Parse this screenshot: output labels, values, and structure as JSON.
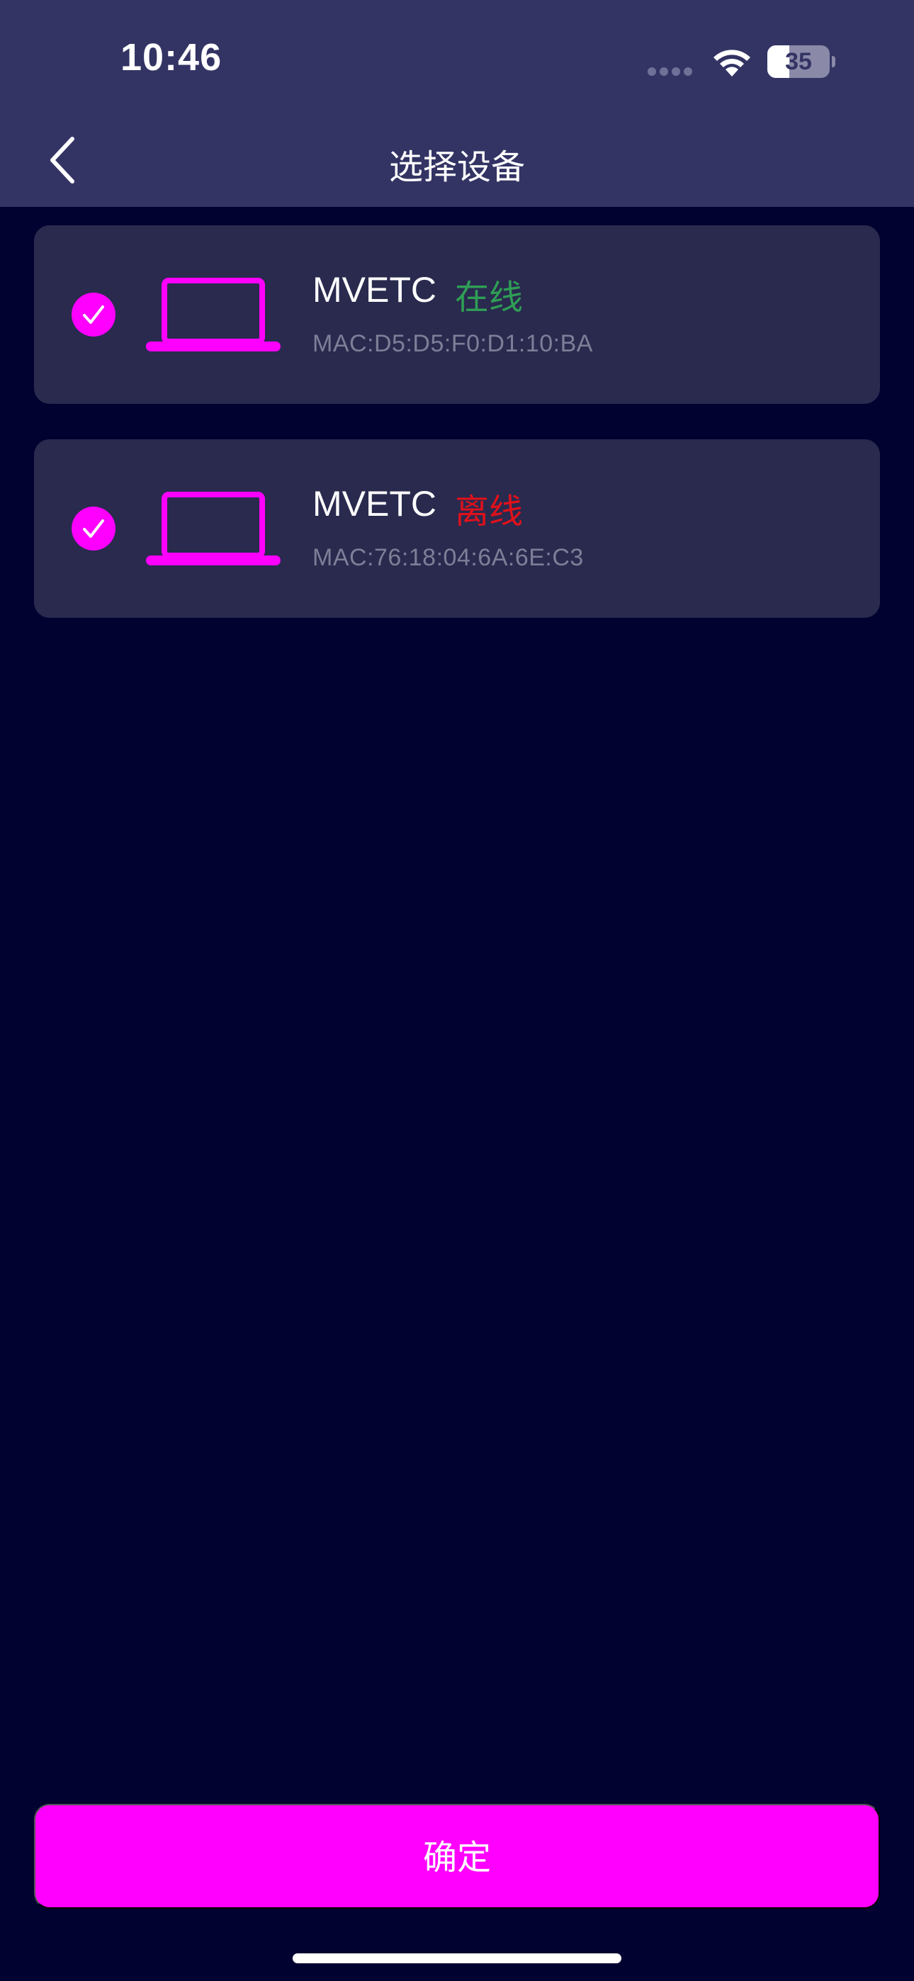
{
  "status_bar": {
    "time": "10:46",
    "battery_level": "35",
    "battery_fraction": 0.35,
    "icons": [
      "signal-dots-icon",
      "wifi-icon",
      "battery-icon"
    ]
  },
  "header": {
    "title": "选择设备",
    "back_icon": "chevron-left-icon"
  },
  "devices": [
    {
      "name": "MVETC",
      "status": "在线",
      "status_color": "#2f9e55",
      "mac": "MAC:D5:D5:F0:D1:10:BA",
      "selected": true
    },
    {
      "name": "MVETC",
      "status": "离线",
      "status_color": "#e0111b",
      "mac": "MAC:76:18:04:6A:6E:C3",
      "selected": true
    }
  ],
  "footer": {
    "confirm_label": "确定"
  },
  "colors": {
    "background": "#020230",
    "header": "#333464",
    "card": "#292a4e",
    "accent": "#ff00ff",
    "online": "#2f9e55",
    "offline": "#e0111b"
  }
}
